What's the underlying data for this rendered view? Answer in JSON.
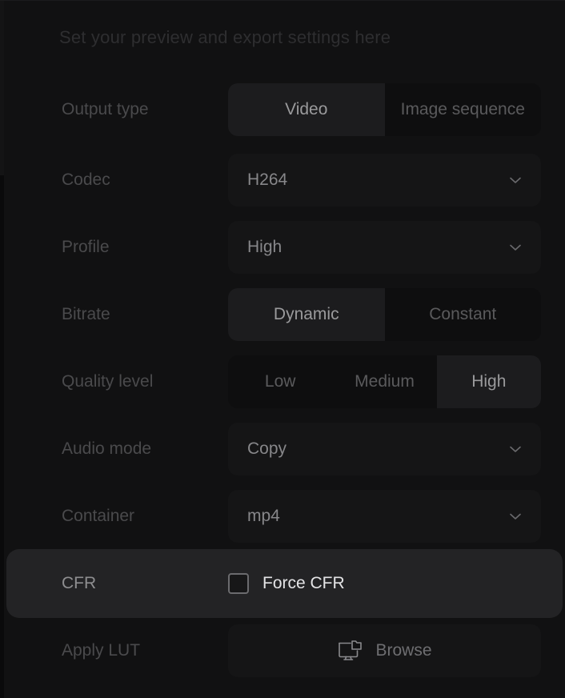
{
  "header": {
    "title": "Set your preview and export settings here"
  },
  "colors": {
    "panel_bg": "#111112",
    "row_highlight_bg": "#232325",
    "control_bg": "#151516",
    "segment_track_bg": "#0e0e0f",
    "segment_selected_bg": "#1c1c1e",
    "label_text": "#4a4a4c",
    "value_text": "#87878a",
    "header_text": "#2e2e30",
    "checkbox_border": "#6b6b6e",
    "check_label_text": "#e4e4e6"
  },
  "rows": [
    {
      "id": "output-type",
      "label": "Output type",
      "type": "segmented",
      "options": [
        "Video",
        "Image sequence"
      ],
      "selected": "Video",
      "selected_index": 0
    },
    {
      "id": "codec",
      "label": "Codec",
      "type": "select",
      "value": "H264",
      "icon": "chevron-down-icon"
    },
    {
      "id": "profile",
      "label": "Profile",
      "type": "select",
      "value": "High",
      "icon": "chevron-down-icon"
    },
    {
      "id": "bitrate",
      "label": "Bitrate",
      "type": "segmented",
      "options": [
        "Dynamic",
        "Constant"
      ],
      "selected": "Dynamic",
      "selected_index": 0
    },
    {
      "id": "quality-level",
      "label": "Quality level",
      "type": "segmented",
      "options": [
        "Low",
        "Medium",
        "High"
      ],
      "selected": "High",
      "selected_index": 2
    },
    {
      "id": "audio-mode",
      "label": "Audio mode",
      "type": "select",
      "value": "Copy",
      "icon": "chevron-down-icon"
    },
    {
      "id": "container",
      "label": "Container",
      "type": "select",
      "value": "mp4",
      "icon": "chevron-down-icon"
    },
    {
      "id": "cfr",
      "label": "CFR",
      "type": "checkbox",
      "checkbox_label": "Force CFR",
      "checked": false,
      "highlighted": true
    },
    {
      "id": "apply-lut",
      "label": "Apply LUT",
      "type": "button",
      "button_label": "Browse",
      "icon": "monitor-folder-icon"
    }
  ]
}
